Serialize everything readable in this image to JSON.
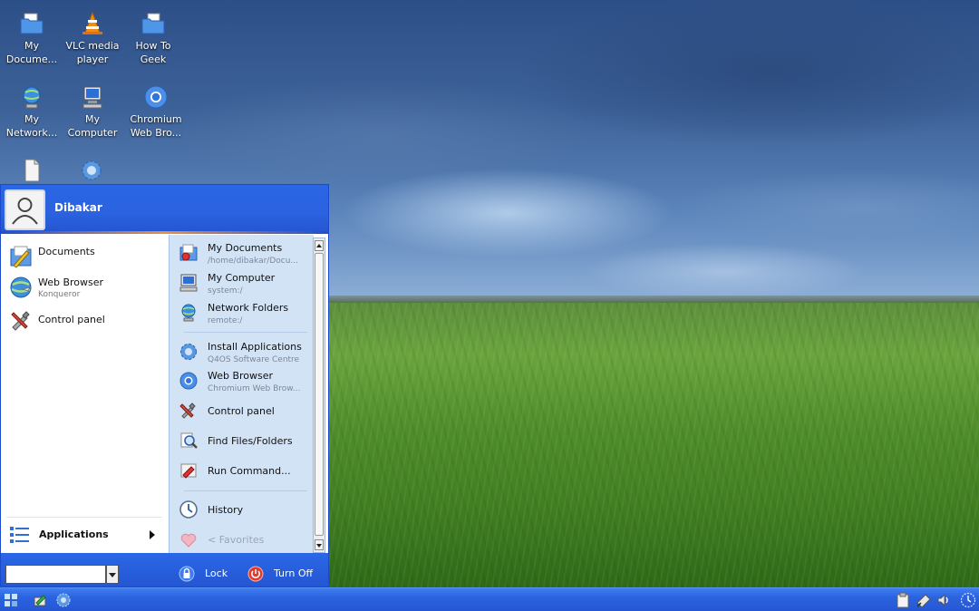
{
  "desktop": {
    "icons": [
      {
        "label_line1": "My",
        "label_line2": "Docume...",
        "icon": "folder-documents-icon"
      },
      {
        "label_line1": "VLC media",
        "label_line2": "player",
        "icon": "vlc-cone-icon"
      },
      {
        "label_line1": "How To",
        "label_line2": "Geek",
        "icon": "folder-icon"
      },
      {
        "label_line1": "My",
        "label_line2": "Network...",
        "icon": "network-globe-icon"
      },
      {
        "label_line1": "My",
        "label_line2": "Computer",
        "icon": "computer-icon"
      },
      {
        "label_line1": "Chromium",
        "label_line2": "Web Bro...",
        "icon": "chromium-icon"
      },
      {
        "label_line1": "",
        "label_line2": "",
        "icon": "document-file-icon"
      },
      {
        "label_line1": "",
        "label_line2": "",
        "icon": "software-centre-icon"
      }
    ]
  },
  "start_menu": {
    "user_name": "Dibakar",
    "left_items": [
      {
        "title": "Documents",
        "subtitle": "",
        "icon": "documents-icon"
      },
      {
        "title": "Web Browser",
        "subtitle": "Konqueror",
        "icon": "globe-icon"
      },
      {
        "title": "Control panel",
        "subtitle": "",
        "icon": "tools-icon"
      }
    ],
    "applications_label": "Applications",
    "right_items": [
      {
        "title": "My Documents",
        "subtitle": "/home/dibakar/Docu...",
        "icon": "my-documents-icon"
      },
      {
        "title": "My Computer",
        "subtitle": "system:/",
        "icon": "computer-icon"
      },
      {
        "title": "Network Folders",
        "subtitle": "remote:/",
        "icon": "network-icon"
      },
      {
        "title": "Install Applications",
        "subtitle": "Q4OS Software Centre",
        "icon": "install-icon"
      },
      {
        "title": "Web Browser",
        "subtitle": "Chromium Web Brow...",
        "icon": "chromium-icon"
      },
      {
        "title": "Control panel",
        "subtitle": "",
        "icon": "tools-icon"
      },
      {
        "title": "Find Files/Folders",
        "subtitle": "",
        "icon": "find-icon"
      },
      {
        "title": "Run Command...",
        "subtitle": "",
        "icon": "run-icon"
      },
      {
        "title": "History",
        "subtitle": "",
        "icon": "history-clock-icon"
      },
      {
        "title": "< Favorites",
        "subtitle": "",
        "icon": "favorites-heart-icon"
      }
    ],
    "footer": {
      "run_field_value": "",
      "lock_label": "Lock",
      "turn_off_label": "Turn Off"
    }
  },
  "taskbar": {
    "left_icons": [
      "start-icon",
      "network-settings-icon",
      "software-centre-icon"
    ],
    "tray_icons": [
      "clipboard-icon",
      "network-tray-icon",
      "volume-icon",
      "clock-icon"
    ]
  },
  "colors": {
    "menu_blue": "#2a66e6",
    "right_pane": "#d3e3f6",
    "taskbar_blue": "#2b62df"
  }
}
